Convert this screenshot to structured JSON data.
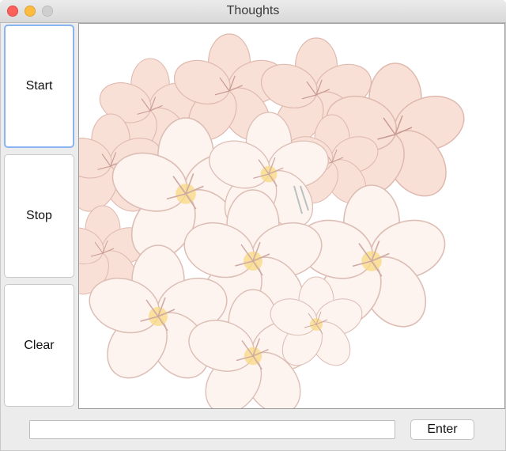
{
  "window": {
    "title": "Thoughts"
  },
  "sidebar": {
    "buttons": [
      {
        "label": "Start"
      },
      {
        "label": "Stop"
      },
      {
        "label": "Clear"
      }
    ]
  },
  "canvas": {
    "image_subject": "cherry blossom bouquet",
    "colors": {
      "petal": "#f8e3dc",
      "petal_outline": "#d9b7ad",
      "center": "#f4c842"
    }
  },
  "input_bar": {
    "value": "",
    "enter_label": "Enter"
  }
}
